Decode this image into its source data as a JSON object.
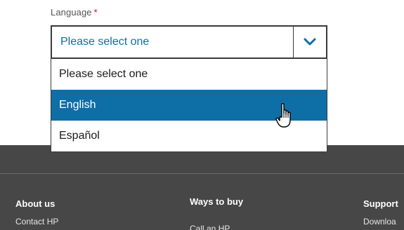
{
  "form": {
    "language_label": "Language",
    "required_mark": "*",
    "select_value": "Please select one",
    "options": [
      "Please select one",
      "English",
      "Español"
    ],
    "highlighted_option": "English"
  },
  "footer": {
    "about": {
      "heading": "About us",
      "links": [
        "Contact HP"
      ]
    },
    "ways": {
      "heading": "Ways to buy",
      "links": [
        "Call an HP"
      ]
    },
    "support": {
      "heading": "Support",
      "links": [
        "Downloa"
      ]
    }
  },
  "colors": {
    "accent": "#0e6ea6",
    "link_text": "#0a6ea8",
    "required": "#d6001c",
    "footer_bg": "#474747"
  },
  "icons": {
    "select_toggle": "chevron-down-icon",
    "pointer": "hand-pointer-icon"
  }
}
